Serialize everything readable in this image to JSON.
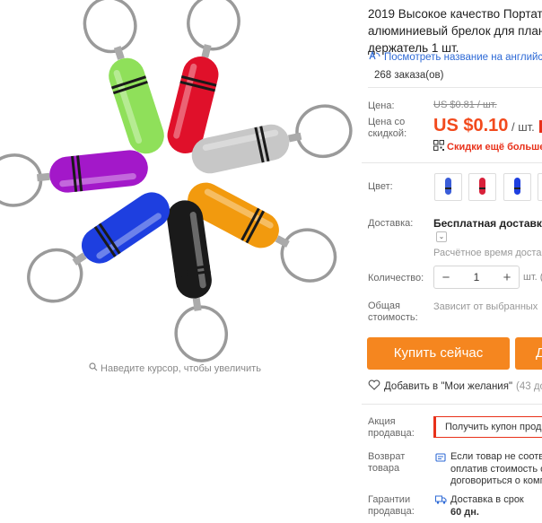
{
  "product": {
    "title_lines": [
      "2019 Высокое качество Портати",
      "алюминиевый брелок для план",
      "держатель 1 шт."
    ],
    "translate_link": "Посмотреть название на английс",
    "orders": "268 заказа(ов)"
  },
  "gallery": {
    "zoom_hint": "Наведите курсор, чтобы увеличить",
    "capsule_colors": [
      "#8fe05a",
      "#e0102a",
      "#c7c7c7",
      "#f29a0e",
      "#1a1a1a",
      "#1e3fe0",
      "#a318c9"
    ]
  },
  "price": {
    "label": "Цена:",
    "old": "US $0.81 / шт.",
    "discount_label_1": "Цена со",
    "discount_label_2": "скидкой:",
    "new": "US $0.10",
    "new_unit": " / шт.",
    "extra": "Скидки ещё больше"
  },
  "color": {
    "label": "Цвет:",
    "swatches": [
      "#3a5dd8",
      "#d8213a",
      "#1e3fe0",
      "#f29a0e"
    ]
  },
  "shipping": {
    "label": "Доставка:",
    "value": "Бесплатная доставка в",
    "time": "Расчётное время достав"
  },
  "quantity": {
    "label": "Количество:",
    "minus": "−",
    "value": "1",
    "plus": "+",
    "unit": "шт. ("
  },
  "total": {
    "label_1": "Общая",
    "label_2": "стоимость:",
    "value": "Зависит от выбранных"
  },
  "actions": {
    "buy": "Купить сейчас",
    "cart": "Д"
  },
  "wishlist": {
    "label": "Добавить в \"Мои желания\"",
    "count": "(43 добав"
  },
  "promo": {
    "label_1": "Акция",
    "label_2": "продавца:",
    "coupon": "Получить купон прод"
  },
  "returns": {
    "label_1": "Возврат",
    "label_2": "товара",
    "line_1": "Если товар не соотве",
    "line_2": "оплатив стоимость с",
    "line_3": "договориться о комп"
  },
  "guarantee": {
    "label_1": "Гарантии",
    "label_2": "продавца:",
    "line_1": "Доставка в срок",
    "line_2": "60 дн."
  },
  "colors": {
    "accent_orange": "#f5861f",
    "price_red": "#f24a1d",
    "link_blue": "#2e6ad6"
  }
}
